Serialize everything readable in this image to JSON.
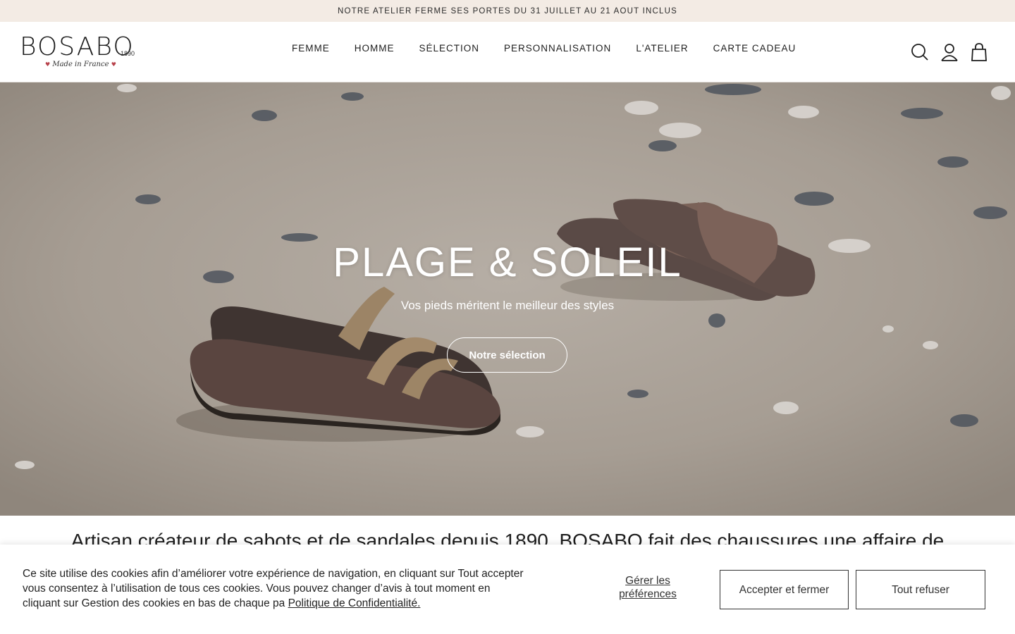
{
  "announcement": {
    "text": "NOTRE ATELIER FERME SES PORTES DU 31 JUILLET AU 21 AOUT INCLUS"
  },
  "logo": {
    "brand": "BOSABO",
    "year": "1890",
    "tagline": "Made in France"
  },
  "nav": {
    "items": [
      {
        "label": "FEMME"
      },
      {
        "label": "HOMME"
      },
      {
        "label": "SÉLECTION"
      },
      {
        "label": "PERSONNALISATION"
      },
      {
        "label": "L'ATELIER"
      },
      {
        "label": "CARTE CADEAU"
      }
    ]
  },
  "header_icons": [
    "search-icon",
    "account-icon",
    "cart-icon"
  ],
  "hero": {
    "title": "PLAGE & SOLEIL",
    "subtitle": "Vos pieds méritent le meilleur des styles",
    "cta_label": "Notre sélection"
  },
  "intro": {
    "text": "Artisan créateur de sabots et de sandales depuis 1890, BOSABO fait des chaussures une affaire de"
  },
  "cookie": {
    "text": "Ce site utilise des cookies afin d’améliorer votre expérience de navigation, en cliquant sur Tout accepter vous consentez à l’utilisation de tous ces cookies. Vous pouvez changer d’avis à tout moment en cliquant sur Gestion des cookies en bas de chaque pa ",
    "policy_link": "Politique de Confidentialité.",
    "manage_label": "Gérer les préférences",
    "accept_label": "Accepter et fermer",
    "refuse_label": "Tout refuser"
  },
  "colors": {
    "announcement_bg": "#f3ebe4",
    "accent_heart": "#b7414a",
    "text": "#1d1d1d"
  }
}
